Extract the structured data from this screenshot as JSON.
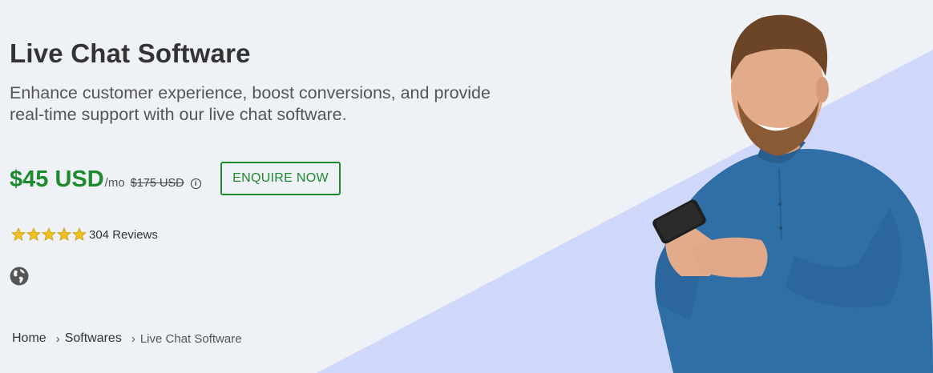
{
  "hero": {
    "title": "Live Chat Software",
    "subtitle": "Enhance customer experience, boost conversions, and provide real-time support with our live chat software."
  },
  "pricing": {
    "price": "$45 USD",
    "period": "/mo",
    "original_price": "$175 USD",
    "info_icon": "info-icon"
  },
  "cta": {
    "enquire_label": "ENQUIRE NOW"
  },
  "rating": {
    "stars": 5,
    "max_stars": 5,
    "reviews_label": "304 Reviews"
  },
  "globe_icon": "globe-icon",
  "breadcrumb": {
    "items": [
      "Home",
      "Softwares",
      "Live Chat Software"
    ],
    "separator": ">"
  },
  "colors": {
    "background": "#eef1f5",
    "accent_triangle": "#cfd8fb",
    "price_green": "#1e8a2e",
    "star_gold": "#f0c020",
    "shirt_blue": "#2f6fa6"
  }
}
